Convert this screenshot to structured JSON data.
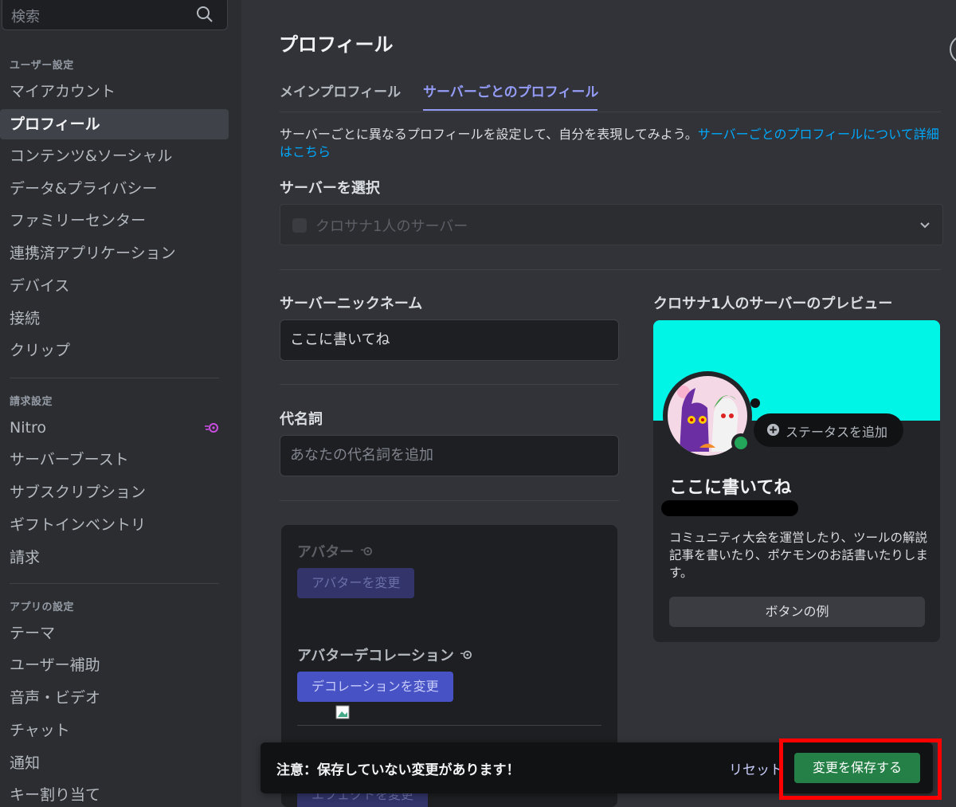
{
  "sidebar": {
    "search_placeholder": "検索",
    "sections": {
      "user": "ユーザー設定",
      "billing": "請求設定",
      "app": "アプリの設定"
    },
    "user_items": [
      "マイアカウント",
      "プロフィール",
      "コンテンツ&ソーシャル",
      "データ&プライバシー",
      "ファミリーセンター",
      "連携済アプリケーション",
      "デバイス",
      "接続",
      "クリップ"
    ],
    "billing_items": [
      "Nitro",
      "サーバーブースト",
      "サブスクリプション",
      "ギフトインベントリ",
      "請求"
    ],
    "app_items": [
      "テーマ",
      "ユーザー補助",
      "音声・ビデオ",
      "チャット",
      "通知",
      "キー割り当て"
    ],
    "active_item": "プロフィール"
  },
  "main": {
    "title": "プロフィール",
    "tabs": [
      "メインプロフィール",
      "サーバーごとのプロフィール"
    ],
    "active_tab": "サーバーごとのプロフィール",
    "description": "サーバーごとに異なるプロフィールを設定して、自分を表現してみよう。",
    "description_link": "サーバーごとのプロフィールについて詳細はこちら",
    "server_select_label": "サーバーを選択",
    "server_selected": "クロサナ1人のサーバー",
    "nickname_label": "サーバーニックネーム",
    "nickname_value": "ここに書いてね",
    "pronouns_label": "代名詞",
    "pronouns_placeholder": "あなたの代名詞を追加",
    "avatar_label": "アバター",
    "avatar_button": "アバターを変更",
    "decoration_label": "アバターデコレーション",
    "decoration_button": "デコレーションを変更",
    "hidden_button": "エフェクトを変更"
  },
  "preview": {
    "title": "クロサナ1人のサーバーのプレビュー",
    "banner_color": "#00f5e6",
    "add_status": "ステータスを追加",
    "display_name": "ここに書いてね",
    "about_me": "コミュニティ大会を運営したり、ツールの解説記事を書いたり、ポケモンのお話書いたりします。",
    "example_button": "ボタンの例"
  },
  "unsaved_bar": {
    "message": "注意：保存していない変更があります！",
    "reset": "リセット",
    "save": "変更を保存する"
  },
  "colors": {
    "accent": "#949cf7",
    "save": "#248046",
    "highlight": "#ff0000"
  }
}
